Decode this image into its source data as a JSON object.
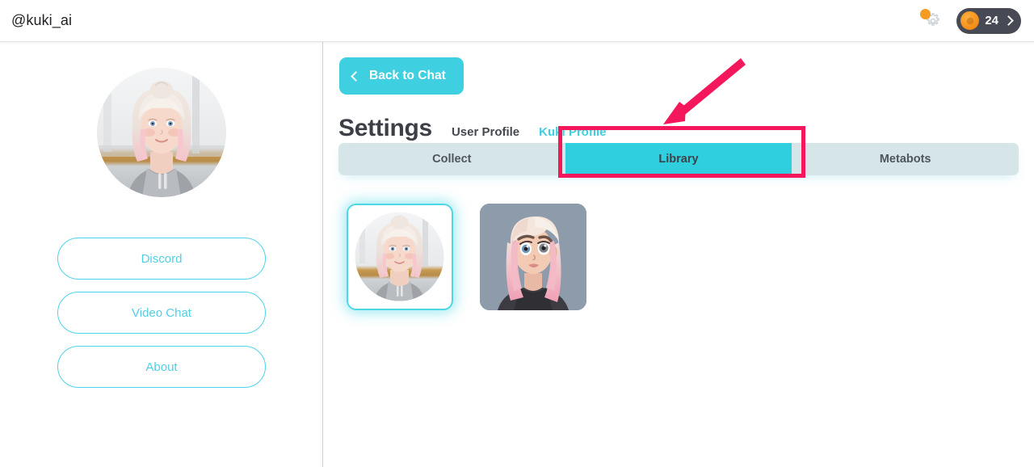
{
  "topbar": {
    "handle": "@kuki_ai",
    "gear_icon": "gear-icon",
    "notification_dot": "notification-dot",
    "coin_icon": "coin-icon",
    "coin_count": "24",
    "chevron_icon": "chevron-right-icon"
  },
  "sidebar": {
    "avatar_alt": "kuki-avatar",
    "buttons": [
      {
        "label": "Discord"
      },
      {
        "label": "Video Chat"
      },
      {
        "label": "About"
      }
    ]
  },
  "main": {
    "back_button": {
      "label": "Back to Chat",
      "icon": "chevron-left-icon"
    },
    "page_title": "Settings",
    "profile_links": [
      {
        "label": "User Profile",
        "active": false
      },
      {
        "label": "Kuki Profile",
        "active": true
      }
    ],
    "tabs": [
      {
        "label": "Collect",
        "active": false
      },
      {
        "label": "Library",
        "active": true
      },
      {
        "label": "Metabots",
        "active": false
      }
    ],
    "avatar_thumbnails": [
      {
        "name": "avatar-realistic-photo",
        "selected": true
      },
      {
        "name": "avatar-illustrated-pink-hair",
        "selected": false
      }
    ]
  },
  "annotations": {
    "highlight_target": "Library",
    "color": "#F4175C"
  },
  "colors": {
    "accent_cyan": "#3ECFE0",
    "tab_inactive_bg": "#D5E5E8",
    "pill_dark": "#474A54",
    "coin_orange": "#F7941E",
    "annotation_pink": "#F4175C",
    "text_dark": "#3C3F46"
  }
}
